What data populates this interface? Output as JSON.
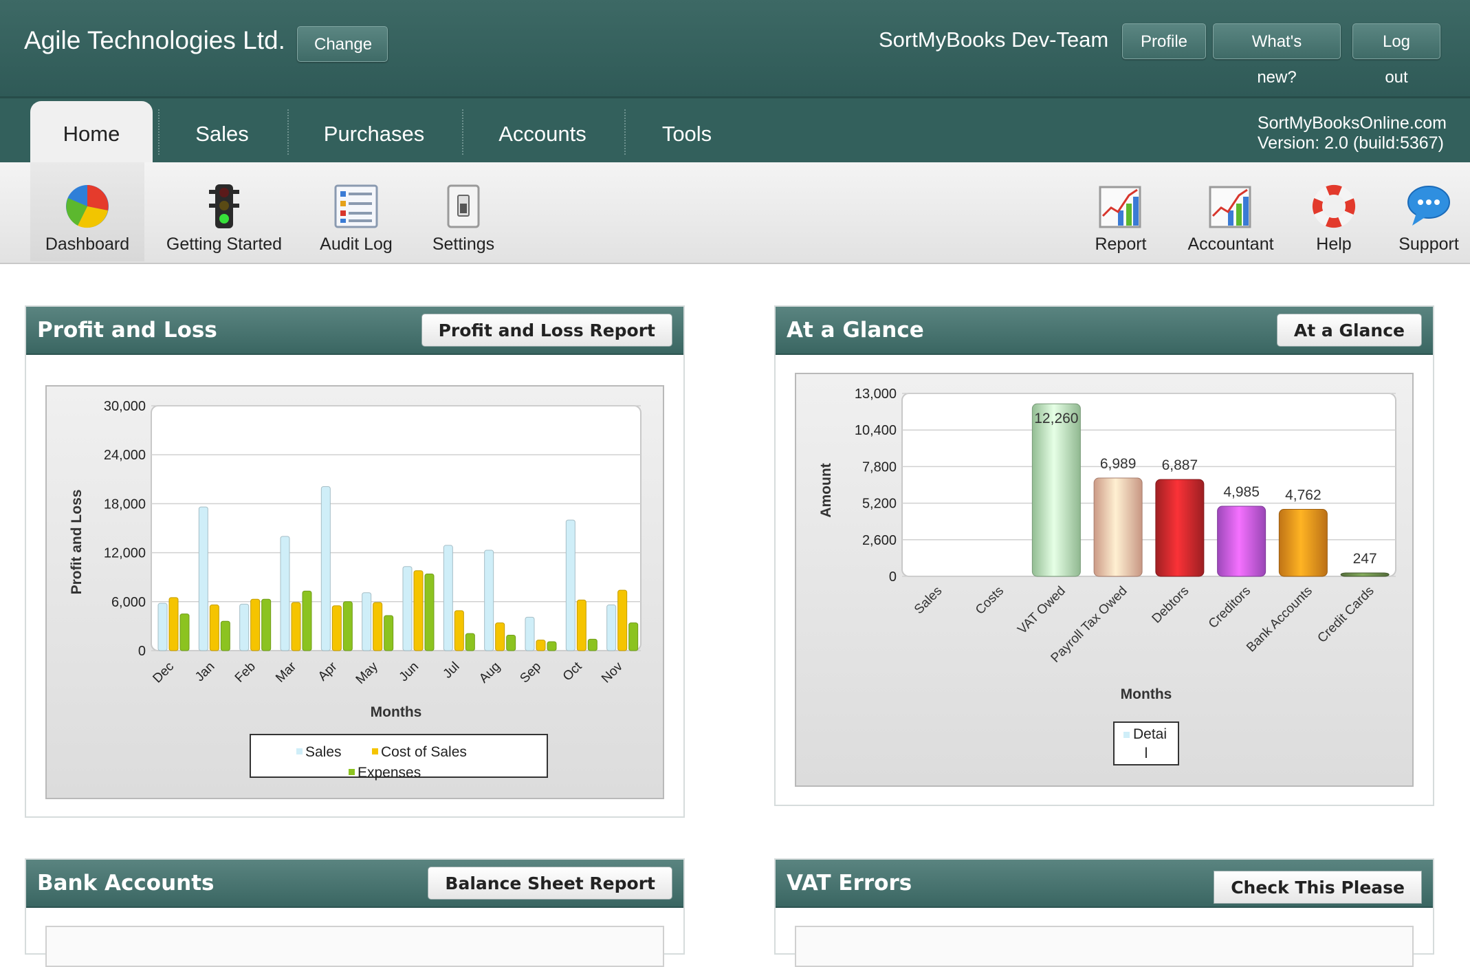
{
  "header": {
    "company": "Agile Technologies Ltd.",
    "change_label": "Change",
    "team": "SortMyBooks Dev-Team",
    "profile_label": "Profile",
    "whats_new_label": "What's new?",
    "logout_label": "Log out"
  },
  "nav": {
    "tabs": [
      "Home",
      "Sales",
      "Purchases",
      "Accounts",
      "Tools"
    ],
    "active": "Home",
    "site": "SortMyBooksOnline.com",
    "version": "Version: 2.0 (build:5367)"
  },
  "toolbar": {
    "left": [
      {
        "label": "Dashboard",
        "icon": "pie-chart-icon"
      },
      {
        "label": "Getting Started",
        "icon": "traffic-light-icon"
      },
      {
        "label": "Audit Log",
        "icon": "audit-list-icon"
      },
      {
        "label": "Settings",
        "icon": "switch-icon"
      }
    ],
    "right": [
      {
        "label": "Report",
        "icon": "report-chart-icon"
      },
      {
        "label": "Accountant",
        "icon": "accountant-chart-icon"
      },
      {
        "label": "Help",
        "icon": "lifebuoy-icon"
      },
      {
        "label": "Support",
        "icon": "chat-bubble-icon"
      }
    ]
  },
  "panels": {
    "pnl": {
      "title": "Profit and Loss",
      "button": "Profit and Loss Report"
    },
    "glance": {
      "title": "At a Glance",
      "button": "At a Glance"
    },
    "bank": {
      "title": "Bank Accounts",
      "button": "Balance Sheet Report"
    },
    "vat": {
      "title": "VAT Errors",
      "button": "Check This Please"
    }
  },
  "colors": {
    "header": "#2f5a57",
    "sales": "#cfeef8",
    "cost_of_sales": "#f5c400",
    "expenses": "#8cc320"
  },
  "chart_data": [
    {
      "type": "bar",
      "categories": [
        "Dec",
        "Jan",
        "Feb",
        "Mar",
        "Apr",
        "May",
        "Jun",
        "Jul",
        "Aug",
        "Sep",
        "Oct",
        "Nov"
      ],
      "series": [
        {
          "name": "Sales",
          "values": [
            5800,
            17600,
            5700,
            14000,
            20100,
            7100,
            10300,
            12900,
            12300,
            4100,
            16000,
            5600
          ]
        },
        {
          "name": "Cost of Sales",
          "values": [
            6500,
            5600,
            6300,
            5900,
            5500,
            5900,
            9800,
            4900,
            3400,
            1300,
            6200,
            7400
          ]
        },
        {
          "name": "Expenses",
          "values": [
            4500,
            3600,
            6300,
            7300,
            6000,
            4300,
            9400,
            2100,
            1900,
            1100,
            1400,
            3400
          ]
        }
      ],
      "yticks": [
        "30,000",
        "24,000",
        "18,000",
        "12,000",
        "6,000",
        "0"
      ],
      "ylim": [
        0,
        30000
      ],
      "xlabel": "Months",
      "ylabel": "Profit and Loss",
      "legend": [
        "Sales",
        "Cost of Sales",
        "Expenses"
      ]
    },
    {
      "type": "bar",
      "categories": [
        "Sales",
        "Costs",
        "VAT Owed",
        "Payroll Tax Owed",
        "Debtors",
        "Creditors",
        "Bank Accounts",
        "Credit Cards"
      ],
      "values": [
        0,
        0,
        12260,
        6989,
        6887,
        4985,
        4762,
        247
      ],
      "labels": [
        "",
        "",
        "12,260",
        "6,989",
        "6,887",
        "4,985",
        "4,762",
        "247"
      ],
      "colors": [
        "#cfeef8",
        "#cfeef8",
        "#b8ecb8",
        "#ffc0a8",
        "#c8282c",
        "#c45ae8",
        "#f0901c",
        "#6a8a4a"
      ],
      "yticks": [
        "13,000",
        "10,400",
        "7,800",
        "5,200",
        "2,600",
        "0"
      ],
      "ylim": [
        0,
        13000
      ],
      "xlabel": "Months",
      "ylabel": "Amount",
      "legend_lines": [
        "Detai",
        "l"
      ]
    }
  ]
}
